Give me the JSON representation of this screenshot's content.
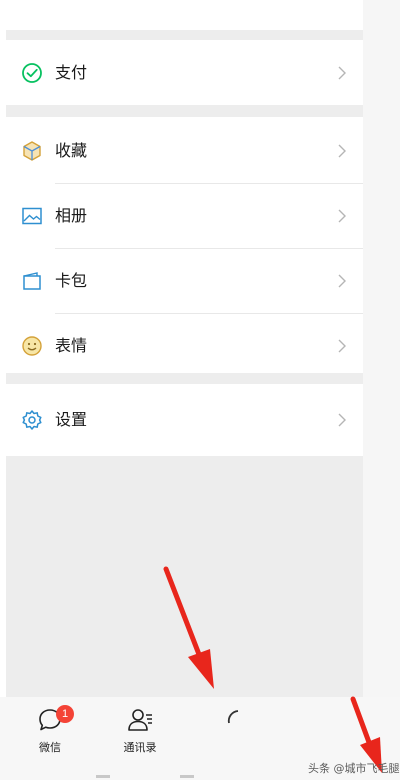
{
  "menu": {
    "pay": {
      "label": "支付",
      "icon": "wechat-pay-icon"
    },
    "favorites": {
      "label": "收藏",
      "icon": "cube-icon"
    },
    "album": {
      "label": "相册",
      "icon": "image-icon"
    },
    "cards": {
      "label": "卡包",
      "icon": "wallet-icon"
    },
    "stickers": {
      "label": "表情",
      "icon": "smiley-icon"
    },
    "settings": {
      "label": "设置",
      "icon": "gear-icon"
    }
  },
  "tabbar": {
    "chats": {
      "label": "微信",
      "badge": "1",
      "icon": "chat-bubble-icon"
    },
    "contacts": {
      "label": "通讯录",
      "icon": "contacts-icon"
    }
  },
  "watermark": "头条 @城市飞毛腿",
  "colors": {
    "accent_green": "#07c160",
    "badge_red": "#f44336",
    "arrow_red": "#e8261c",
    "background_gray": "#ededed"
  }
}
